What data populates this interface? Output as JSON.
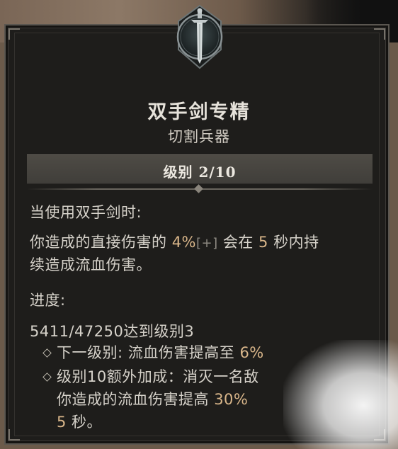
{
  "tooltip": {
    "title": "双手剑专精",
    "subtitle": "切割兵器",
    "rank_label": "级别 2/10",
    "condition": "当使用双手剑时:",
    "desc": {
      "line1_a": "你造成的直接伤害的 ",
      "line1_pct": "4%",
      "line1_plus": "[+]",
      "line1_b": " 会在 ",
      "line1_num": "5",
      "line1_c": " 秒内持",
      "line2": "续造成流血伤害。"
    },
    "progress_label": "进度:",
    "progress_value": "5411/47250达到级别3",
    "bullets": {
      "b1_a": "下一级别: 流血伤害提高至 ",
      "b1_pct": "6%",
      "b2_a": "级别10额外加成：消灭一名敌",
      "b3_a": "你造成的流血伤害提高 ",
      "b3_pct": "30%",
      "b4_num": "5",
      "b4_b": " 秒。"
    }
  },
  "colors": {
    "highlight": "#d9b68a",
    "text": "#d6d2ca",
    "panel_bg": "#1e1d1b"
  },
  "icons": {
    "emblem": "sword-emblem-icon"
  }
}
